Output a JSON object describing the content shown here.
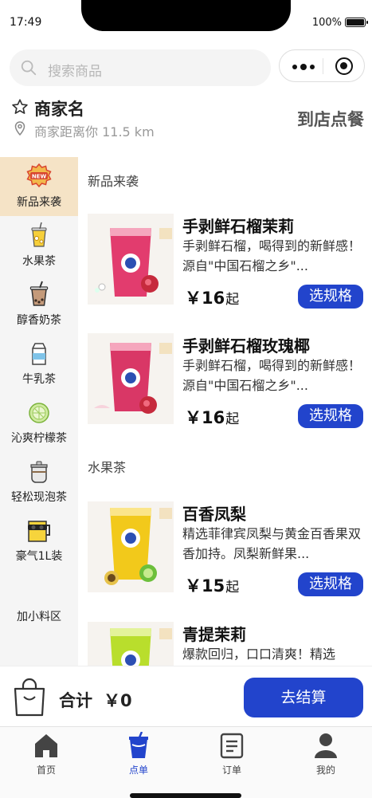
{
  "status_bar": {
    "time": "17:49",
    "battery": "100%"
  },
  "search": {
    "placeholder": "搜索商品"
  },
  "merchant": {
    "name": "商家名",
    "distance": "商家距离你 11.5 km",
    "dine_in": "到店点餐"
  },
  "sidebar": {
    "items": [
      {
        "label": "新品来袭",
        "icon": "new-badge-icon"
      },
      {
        "label": "水果茶",
        "icon": "fruit-tea-icon"
      },
      {
        "label": "醇香奶茶",
        "icon": "milk-tea-icon"
      },
      {
        "label": "牛乳茶",
        "icon": "milk-carton-icon"
      },
      {
        "label": "沁爽柠檬茶",
        "icon": "lemon-icon"
      },
      {
        "label": "轻松现泡茶",
        "icon": "teapot-icon"
      },
      {
        "label": "豪气1L装",
        "icon": "big-cup-icon"
      }
    ],
    "extra": "加小料区"
  },
  "sections": [
    {
      "title": "新品来袭",
      "products": [
        {
          "name": "手剥鲜石榴茉莉",
          "desc": "手剥鲜石榴，喝得到的新鲜感！源自\"中国石榴之乡\"...",
          "currency": "￥",
          "price": "16",
          "unit": "起",
          "button": "选规格",
          "color": "#e23c6e"
        },
        {
          "name": "手剥鲜石榴玫瑰椰",
          "desc": "手剥鲜石榴，喝得到的新鲜感！源自\"中国石榴之乡\"...",
          "currency": "￥",
          "price": "16",
          "unit": "起",
          "button": "选规格",
          "color": "#d93766"
        }
      ]
    },
    {
      "title": "水果茶",
      "products": [
        {
          "name": "百香凤梨",
          "desc": "精选菲律宾凤梨与黄金百香果双香加持。凤梨新鲜果...",
          "currency": "￥",
          "price": "15",
          "unit": "起",
          "button": "选规格",
          "color": "#f2c91b"
        },
        {
          "name": "青提茉莉",
          "desc": "爆款回归，口口清爽！精选",
          "color": "#b9de2c"
        }
      ]
    }
  ],
  "cart": {
    "total_label": "合计",
    "total_value": "￥0",
    "checkout": "去结算"
  },
  "tabbar": {
    "items": [
      {
        "label": "首页",
        "icon": "home-icon"
      },
      {
        "label": "点单",
        "icon": "order-cup-icon"
      },
      {
        "label": "订单",
        "icon": "receipt-icon"
      },
      {
        "label": "我的",
        "icon": "user-icon"
      }
    ]
  },
  "colors": {
    "accent": "#2244cc",
    "sidebar_active": "#f5e3c6",
    "sidebar_bg": "#f5f5f5"
  }
}
